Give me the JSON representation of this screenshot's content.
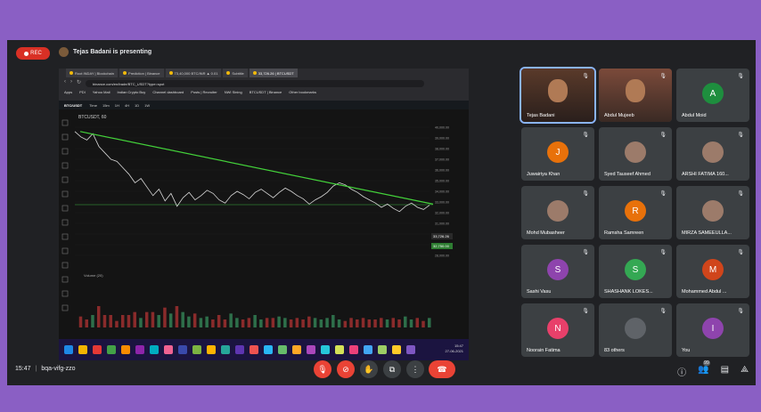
{
  "meeting": {
    "rec_label": "REC",
    "presenting_text": "Tejas Badani is presenting",
    "time": "15:47",
    "meeting_code": "bqa-vifg-zzo"
  },
  "browser": {
    "tabs": [
      "Root INDAY | Blockchain",
      "Prediction | Binance",
      "73,40,000 BTC/INR ▲ 0.01",
      "Subtitle",
      "33,726.26 | BTCUSDT"
    ],
    "address": "binance.com/en/trade/BTC_USDT?type=spot",
    "bookmarks": [
      "Apps",
      "PDI",
      "Yahoo Mail",
      "Indian Crypto Buy",
      "Channel dashboard",
      "Posts | Recruiter",
      "NWI Sining",
      "BTCUSDT | Binance",
      "Other bookmarks"
    ],
    "pair_label": "BTC/USDT",
    "chart_toolbar": [
      "Time",
      "15m",
      "1H",
      "4H",
      "1D",
      "1W"
    ]
  },
  "chart_data": {
    "type": "line",
    "title": "BTCUSDT, 60",
    "y_ticks": [
      "40,000.00",
      "39,000.00",
      "38,000.00",
      "37,000.00",
      "36,000.00",
      "35,000.00",
      "34,000.00",
      "33,000.00",
      "32,000.00",
      "31,000.00",
      "30,000.00",
      "29,000.00",
      "28,000.00"
    ],
    "ylim": [
      27500,
      40500
    ],
    "price_last": "33,726.26",
    "support_label": "32,750.00",
    "values": [
      39600,
      39100,
      38800,
      39400,
      38200,
      37600,
      37000,
      36800,
      36200,
      35600,
      34800,
      35200,
      34400,
      33600,
      34200,
      33100,
      33800,
      32600,
      33400,
      33900,
      33200,
      33600,
      34100,
      33800,
      33200,
      32900,
      33600,
      34000,
      33700,
      33300,
      33900,
      34200,
      33800,
      33400,
      33900,
      34300,
      34000,
      33600,
      33300,
      32800,
      33200,
      33500,
      33900,
      34500,
      34800,
      34600,
      34200,
      33900,
      33500,
      33200,
      32900,
      32500,
      32800,
      32400,
      32100,
      32600,
      32900,
      32500,
      32300,
      32700
    ],
    "trendline": {
      "from": 39600,
      "to": 32800
    },
    "support_level": 32750,
    "volume_label": "Volume (20)"
  },
  "taskbar": {
    "time": "15:47",
    "date": "27-06-2021"
  },
  "participants": [
    {
      "name": "Tejas Badani",
      "type": "video"
    },
    {
      "name": "Abdul Mujeeb",
      "type": "video"
    },
    {
      "name": "Abdul Moid",
      "initial": "A",
      "color": "#1e8e3e"
    },
    {
      "name": "Juwairiya Khan",
      "initial": "J",
      "color": "#e8710a"
    },
    {
      "name": "Syed Tauseef Ahmed",
      "type": "photo"
    },
    {
      "name": "ARSHI FATIMA 160...",
      "type": "photo"
    },
    {
      "name": "Mohd Mubasheer",
      "type": "photo"
    },
    {
      "name": "Ramsha Samreen",
      "initial": "R",
      "color": "#e8710a"
    },
    {
      "name": "MIRZA SAMEEULLA...",
      "type": "photo"
    },
    {
      "name": "Sashi Vasu",
      "initial": "S",
      "color": "#8e44ad"
    },
    {
      "name": "SHASHANK LOKES...",
      "initial": "S",
      "color": "#34a853"
    },
    {
      "name": "Mohammed Abdul ...",
      "initial": "M",
      "color": "#d0451b"
    },
    {
      "name": "Noorain Fatima",
      "initial": "N",
      "color": "#e8406a"
    },
    {
      "name": "83 others",
      "type": "others"
    },
    {
      "name": "You",
      "initial": "I",
      "color": "#8e44ad"
    }
  ],
  "colors": {
    "end_call": "#ea4335",
    "mic_off": "#ea4335",
    "surface": "#202124",
    "tile": "#3c4043"
  },
  "icons": {
    "mic": "mic-off-icon",
    "cam": "camera-off-icon",
    "hand": "raise-hand-icon",
    "present": "present-icon",
    "more": "more-vert-icon",
    "end": "end-call-icon",
    "info": "info-icon",
    "people": "people-icon",
    "chat": "chat-icon",
    "activities": "activities-icon"
  },
  "people_count": "99"
}
